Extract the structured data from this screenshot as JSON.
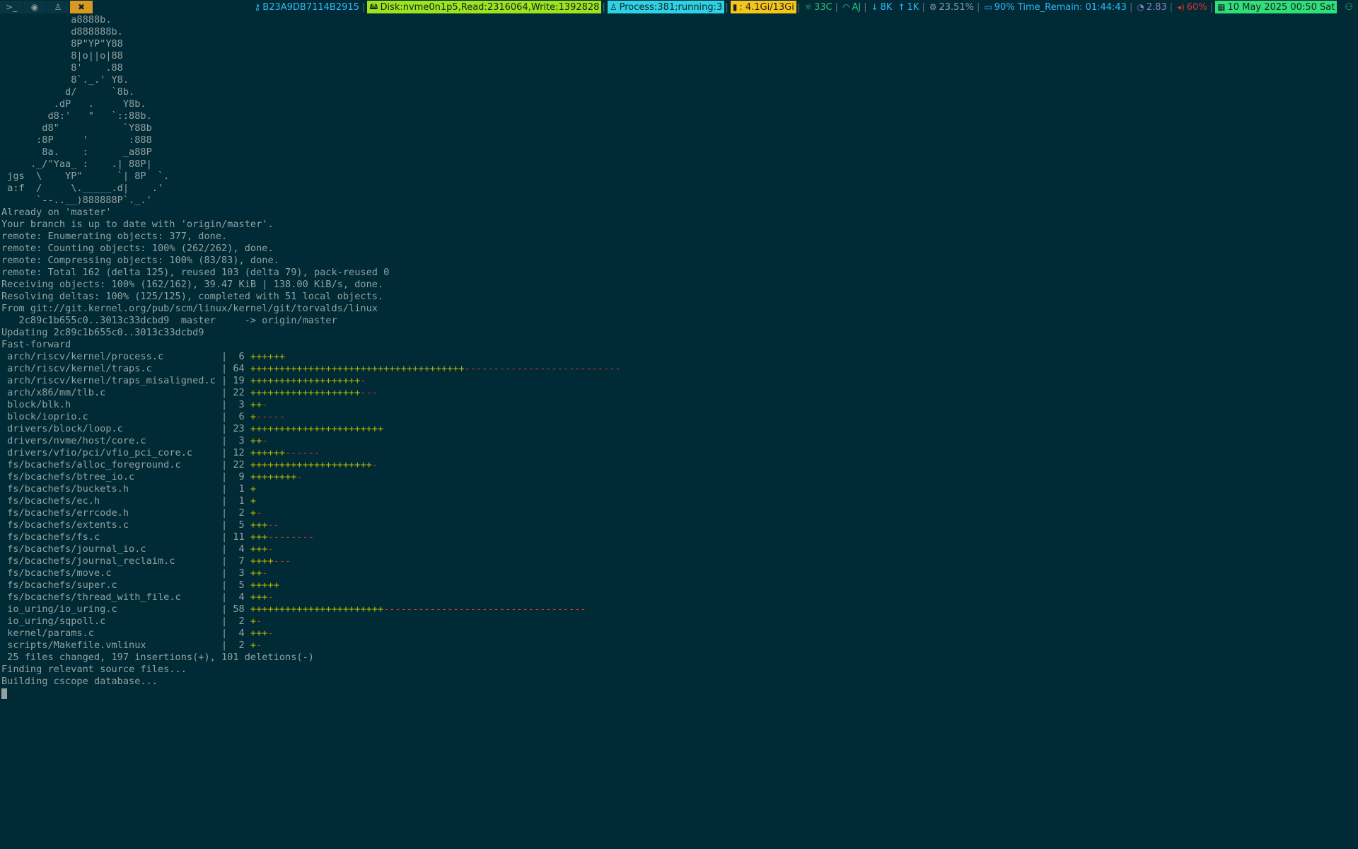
{
  "workspaces": [
    {
      "icon": ">_",
      "name": "terminal-workspace-icon",
      "active": false
    },
    {
      "icon": "◉",
      "name": "browser-workspace-icon",
      "active": false
    },
    {
      "icon": "♙",
      "name": "linux-workspace-icon",
      "active": false
    },
    {
      "icon": "✖",
      "name": "tools-workspace-icon",
      "active": true
    }
  ],
  "status": {
    "key": {
      "icon": "⚷",
      "text": "B23A9DB7114B2915"
    },
    "disk": {
      "icon": "🖴",
      "text": "Disk:nvme0n1p5,Read:2316064,Write:1392828",
      "bg": "#9be51d",
      "fg": "#1d2021"
    },
    "process": {
      "icon": "♙",
      "text": "Process:381;running:3",
      "bg": "#2ad4e6",
      "fg": "#1d2021"
    },
    "memory": {
      "icon": "▮",
      "text": ": 4.1Gi/13Gi",
      "bg": "#f5c518",
      "fg": "#1d2021"
    },
    "temp": {
      "icon": "☼",
      "text": "33C",
      "fg": "#2ec27e"
    },
    "wifi": {
      "icon": "◠",
      "text": "AJ",
      "fg": "#2ec27e"
    },
    "net_down": {
      "icon": "↓",
      "text": "8K",
      "fg": "#33b6f5"
    },
    "net_up": {
      "icon": "↑",
      "text": "1K",
      "fg": "#33b6f5"
    },
    "cpu": {
      "icon": "⚙",
      "text": "23.51%",
      "fg": "#8b9aa3"
    },
    "battery": {
      "icon": "▭",
      "text": "90% Time_Remain: 01:44:43",
      "fg": "#33b6f5"
    },
    "load": {
      "icon": "◔",
      "text": "2.83",
      "fg": "#8e7cc3"
    },
    "volume": {
      "icon": "◂)",
      "text": "60%",
      "fg": "#e0302f"
    },
    "date": {
      "icon": "▦",
      "text": "10 May 2025 00:50 Sat",
      "bg": "#2ee07a",
      "fg": "#1d2021"
    },
    "tray": {
      "icon": "⚇",
      "fg": "#2ec27e"
    }
  },
  "terminal": {
    "lines": [
      {
        "t": "            a8888b."
      },
      {
        "t": "            d888888b."
      },
      {
        "t": "            8P\"YP\"Y88"
      },
      {
        "t": "            8|o||o|88"
      },
      {
        "t": "            8'    .88"
      },
      {
        "t": "            8`._.' Y8."
      },
      {
        "t": "           d/      `8b."
      },
      {
        "t": "         .dP   .     Y8b."
      },
      {
        "t": "        d8:'   \"   `::88b."
      },
      {
        "t": "       d8\"           `Y88b"
      },
      {
        "t": "      :8P     '       :888"
      },
      {
        "t": "       8a.    :      _a88P"
      },
      {
        "t": "     ._/\"Yaa_ :    .| 88P|"
      },
      {
        "t": " jgs  \\    YP\"      `| 8P  `."
      },
      {
        "t": " a:f  /     \\._____.d|    .'"
      },
      {
        "t": "      `--..__)888888P`._.'"
      },
      {
        "t": "Already on 'master'"
      },
      {
        "t": "Your branch is up to date with 'origin/master'."
      },
      {
        "t": "remote: Enumerating objects: 377, done."
      },
      {
        "t": "remote: Counting objects: 100% (262/262), done."
      },
      {
        "t": "remote: Compressing objects: 100% (83/83), done."
      },
      {
        "t": "remote: Total 162 (delta 125), reused 103 (delta 79), pack-reused 0"
      },
      {
        "t": "Receiving objects: 100% (162/162), 39.47 KiB | 138.00 KiB/s, done."
      },
      {
        "t": "Resolving deltas: 100% (125/125), completed with 51 local objects."
      },
      {
        "t": "From git://git.kernel.org/pub/scm/linux/kernel/git/torvalds/linux"
      },
      {
        "t": "   2c89c1b655c0..3013c33dcbd9  master     -> origin/master"
      },
      {
        "t": "Updating 2c89c1b655c0..3013c33dcbd9"
      },
      {
        "t": "Fast-forward"
      },
      {
        "t": " arch/riscv/kernel/process.c          |  6 ",
        "p": "++++++",
        "m": ""
      },
      {
        "t": " arch/riscv/kernel/traps.c            | 64 ",
        "p": "+++++++++++++++++++++++++++++++++++++",
        "m": "---------------------------"
      },
      {
        "t": " arch/riscv/kernel/traps_misaligned.c | 19 ",
        "p": "+++++++++++++++++++",
        "m": "-"
      },
      {
        "t": " arch/x86/mm/tlb.c                    | 22 ",
        "p": "+++++++++++++++++++",
        "m": "---"
      },
      {
        "t": " block/blk.h                          |  3 ",
        "p": "++",
        "m": "-"
      },
      {
        "t": " block/ioprio.c                       |  6 ",
        "p": "+",
        "m": "-----"
      },
      {
        "t": " drivers/block/loop.c                 | 23 ",
        "p": "+++++++++++++++++++++++",
        "m": ""
      },
      {
        "t": " drivers/nvme/host/core.c             |  3 ",
        "p": "++",
        "m": "-"
      },
      {
        "t": " drivers/vfio/pci/vfio_pci_core.c     | 12 ",
        "p": "++++++",
        "m": "------"
      },
      {
        "t": " fs/bcachefs/alloc_foreground.c       | 22 ",
        "p": "+++++++++++++++++++++",
        "m": "-"
      },
      {
        "t": " fs/bcachefs/btree_io.c               |  9 ",
        "p": "++++++++",
        "m": "-"
      },
      {
        "t": " fs/bcachefs/buckets.h                |  1 ",
        "p": "+",
        "m": ""
      },
      {
        "t": " fs/bcachefs/ec.h                     |  1 ",
        "p": "+",
        "m": ""
      },
      {
        "t": " fs/bcachefs/errcode.h                |  2 ",
        "p": "+",
        "m": "-"
      },
      {
        "t": " fs/bcachefs/extents.c                |  5 ",
        "p": "+++",
        "m": "--"
      },
      {
        "t": " fs/bcachefs/fs.c                     | 11 ",
        "p": "+++",
        "m": "--------"
      },
      {
        "t": " fs/bcachefs/journal_io.c             |  4 ",
        "p": "+++",
        "m": "-"
      },
      {
        "t": " fs/bcachefs/journal_reclaim.c        |  7 ",
        "p": "++++",
        "m": "---"
      },
      {
        "t": " fs/bcachefs/move.c                   |  3 ",
        "p": "++",
        "m": "-"
      },
      {
        "t": " fs/bcachefs/super.c                  |  5 ",
        "p": "+++++",
        "m": ""
      },
      {
        "t": " fs/bcachefs/thread_with_file.c       |  4 ",
        "p": "+++",
        "m": "-"
      },
      {
        "t": " io_uring/io_uring.c                  | 58 ",
        "p": "+++++++++++++++++++++++",
        "m": "-----------------------------------"
      },
      {
        "t": " io_uring/sqpoll.c                    |  2 ",
        "p": "+",
        "m": "-"
      },
      {
        "t": " kernel/params.c                      |  4 ",
        "p": "+++",
        "m": "-"
      },
      {
        "t": " scripts/Makefile.vmlinux             |  2 ",
        "p": "+",
        "m": "-"
      },
      {
        "t": " 25 files changed, 197 insertions(+), 101 deletions(-)"
      },
      {
        "t": "Finding relevant source files..."
      },
      {
        "t": "Building cscope database..."
      }
    ]
  }
}
